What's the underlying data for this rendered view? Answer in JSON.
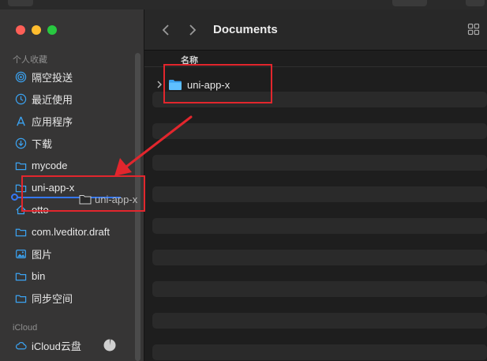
{
  "window": {
    "title": "Documents"
  },
  "sidebar": {
    "favorites_label": "个人收藏",
    "items": [
      {
        "label": "隔空投送",
        "icon": "airdrop-icon"
      },
      {
        "label": "最近使用",
        "icon": "recents-clock-icon"
      },
      {
        "label": "应用程序",
        "icon": "applications-icon"
      },
      {
        "label": "下载",
        "icon": "downloads-icon"
      },
      {
        "label": "mycode",
        "icon": "folder-icon"
      },
      {
        "label": "uni-app-x",
        "icon": "folder-icon"
      },
      {
        "label": "otto",
        "icon": "home-icon"
      },
      {
        "label": "com.lveditor.draft",
        "icon": "folder-icon"
      },
      {
        "label": "图片",
        "icon": "pictures-icon"
      },
      {
        "label": "bin",
        "icon": "folder-icon"
      },
      {
        "label": "同步空间",
        "icon": "folder-icon"
      }
    ],
    "icloud_label": "iCloud",
    "icloud_items": [
      {
        "label": "iCloud云盘",
        "icon": "icloud-icon"
      }
    ]
  },
  "list": {
    "column_name": "名称",
    "rows": [
      {
        "name": "uni-app-x",
        "icon": "folder-blue-icon",
        "expandable": true
      }
    ]
  },
  "drag": {
    "ghost_label": "uni-app-x"
  },
  "colors": {
    "accent": "#3578f6",
    "annotation": "#e2262d",
    "folder": "#3ba3f2"
  }
}
